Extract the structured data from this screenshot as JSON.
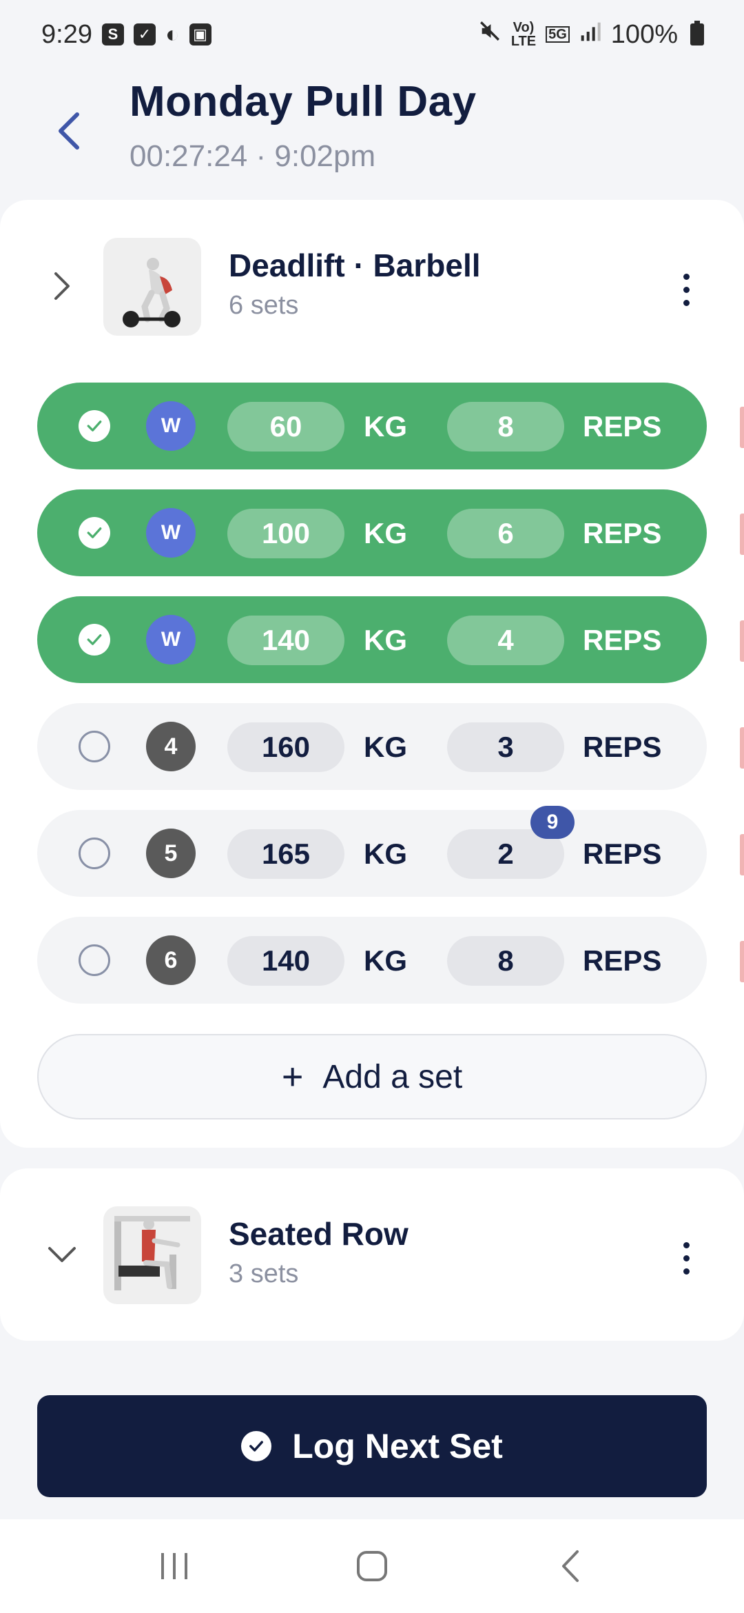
{
  "status_bar": {
    "time": "9:29",
    "icons_left": [
      "s-app-icon",
      "check-icon",
      "moon-icon",
      "image-icon"
    ],
    "network_top": "Vo)",
    "network_bottom": "LTE",
    "fiveg": "5G",
    "battery": "100%"
  },
  "header": {
    "title": "Monday Pull Day",
    "subtitle": "00:27:24 · 9:02pm"
  },
  "exercises": [
    {
      "name": "Deadlift · Barbell",
      "sets_label": "6 sets",
      "expanded": true,
      "sets": [
        {
          "badge": "W",
          "weight": "60",
          "unit": "KG",
          "reps": "8",
          "reps_unit": "REPS",
          "completed": true
        },
        {
          "badge": "W",
          "weight": "100",
          "unit": "KG",
          "reps": "6",
          "reps_unit": "REPS",
          "completed": true
        },
        {
          "badge": "W",
          "weight": "140",
          "unit": "KG",
          "reps": "4",
          "reps_unit": "REPS",
          "completed": true
        },
        {
          "badge": "4",
          "weight": "160",
          "unit": "KG",
          "reps": "3",
          "reps_unit": "REPS",
          "completed": false
        },
        {
          "badge": "5",
          "weight": "165",
          "unit": "KG",
          "reps": "2",
          "reps_unit": "REPS",
          "completed": false,
          "hint": "9"
        },
        {
          "badge": "6",
          "weight": "140",
          "unit": "KG",
          "reps": "8",
          "reps_unit": "REPS",
          "completed": false
        }
      ],
      "add_set_label": "Add a set"
    },
    {
      "name": "Seated Row",
      "sets_label": "3 sets",
      "expanded": false
    }
  ],
  "log_button": "Log Next Set",
  "colors": {
    "navy": "#121d3f",
    "done_green": "#4caf6e",
    "warmup_blue": "#5b74d8",
    "accent_blue": "#3f56a8"
  }
}
